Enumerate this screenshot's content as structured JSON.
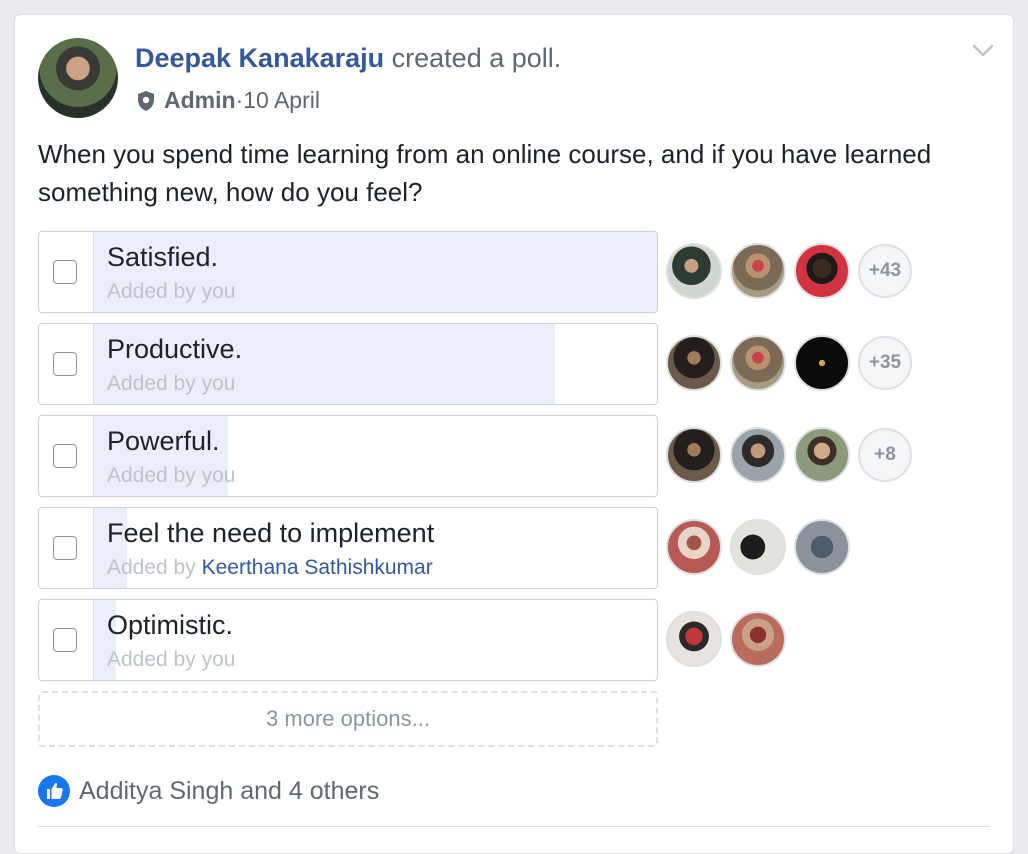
{
  "post": {
    "author": "Deepak Kanakaraju",
    "action": "created a poll.",
    "role": "Admin",
    "date_sep": " · ",
    "date": "10 April"
  },
  "poll": {
    "question": "When you spend time learning from an online course, and if you have learned something new, how do you feel?",
    "options": [
      {
        "label": "Satisfied.",
        "added_prefix": "Added by",
        "added_by": "you",
        "fill": 1.0,
        "more_voters": "+43"
      },
      {
        "label": "Productive.",
        "added_prefix": "Added by",
        "added_by": "you",
        "fill": 0.82,
        "more_voters": "+35"
      },
      {
        "label": "Powerful.",
        "added_prefix": "Added by",
        "added_by": "you",
        "fill": 0.24,
        "more_voters": "+8"
      },
      {
        "label": "Feel the need to implement",
        "added_prefix": "Added by",
        "added_by": "Keerthana Sathishkumar",
        "fill": 0.06,
        "more_voters": ""
      },
      {
        "label": "Optimistic.",
        "added_prefix": "Added by",
        "added_by": "you",
        "fill": 0.04,
        "more_voters": ""
      }
    ],
    "more_options": "3 more options..."
  },
  "reactions": {
    "text": "Additya Singh and 4 others"
  },
  "colors": {
    "link": "#365899",
    "poll_fill": "#e9eef8",
    "like_blue": "#1877f2"
  }
}
